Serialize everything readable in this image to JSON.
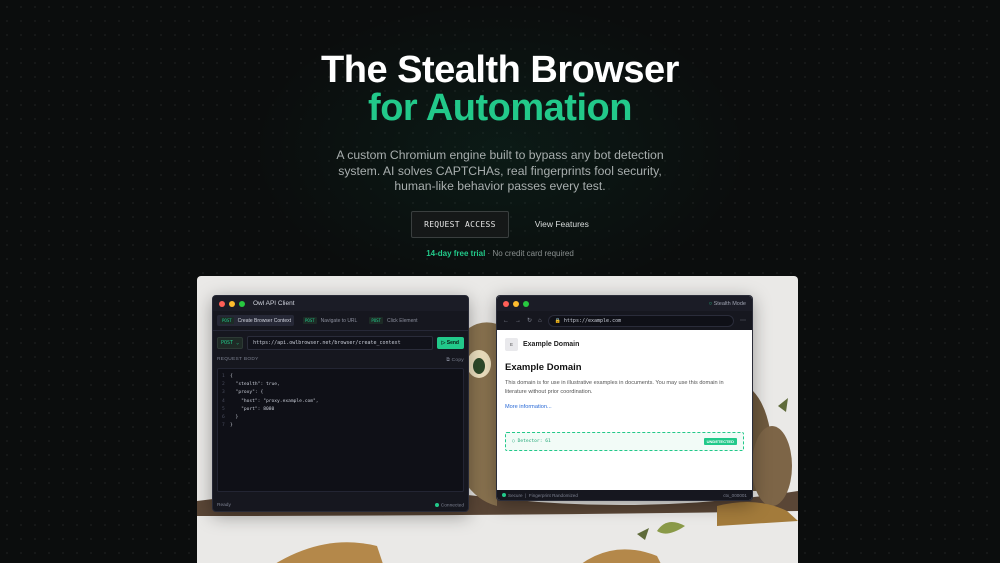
{
  "hero": {
    "title_line1": "The Stealth Browser",
    "title_line2": "for Automation",
    "subtitle": "A custom Chromium engine built to bypass any bot detection system. AI solves CAPTCHAs, real fingerprints fool security, human-like behavior passes every test.",
    "cta_primary": "REQUEST ACCESS",
    "cta_secondary": "View Features",
    "trial_highlight": "14-day free trial",
    "trial_rest": " · No credit card required"
  },
  "api_client": {
    "title": "Owl API Client",
    "tabs": [
      {
        "method": "POST",
        "label": "Create Browser Context"
      },
      {
        "method": "POST",
        "label": "Navigate to URL"
      },
      {
        "method": "POST",
        "label": "Click Element"
      }
    ],
    "method": "POST",
    "url": "https://api.owlbrowser.net/browser/create_context",
    "send_label": "Send",
    "body_label": "REQUEST BODY",
    "copy_label": "Copy",
    "code": {
      "l1": "{",
      "l2": "\"stealth\": true,",
      "l3": "\"proxy\": {",
      "l4": "\"host\": \"proxy.example.com\",",
      "l5": "\"port\": 8080",
      "l6": "}",
      "l7": "}"
    },
    "status_left": "Ready",
    "status_right": "Connected"
  },
  "browser": {
    "mode_label": "Stealth Mode",
    "address": "https://example.com",
    "favicon": "E",
    "site_name": "Example Domain",
    "heading": "Example Domain",
    "paragraph": "This domain is for use in illustrative examples in documents. You may use this domain in literature without prior coordination.",
    "link": "More information...",
    "detector": "Detector: 61",
    "detector_badge": "UNDETECTED",
    "status_secure": "Secure",
    "status_fingerprint": "Fingerprint Randomized",
    "status_id": "ctx_000001"
  },
  "colors": {
    "accent": "#22c98a",
    "background": "#0b0d0d"
  }
}
